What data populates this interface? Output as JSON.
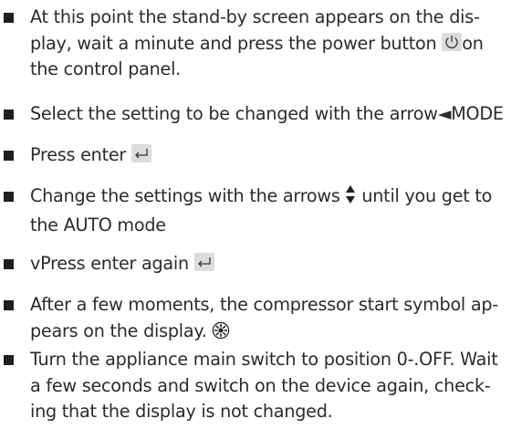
{
  "steps": [
    {
      "lines": [
        "At this point the stand-by screen appears on the dis-",
        "play, wait a minute and press the power button",
        "on",
        "the control panel."
      ],
      "icon": "power-icon"
    },
    {
      "text": "Select the setting to be changed with the arrow◄MODE"
    },
    {
      "text": "Press enter",
      "icon": "enter-icon"
    },
    {
      "text_before": "Change the settings with the arrows",
      "text_after": "until you get to",
      "text_line2": "the AUTO mode",
      "icon": "up-down-arrows-icon"
    },
    {
      "text": "vPress enter again",
      "icon": "enter-icon"
    },
    {
      "line1": "After a few moments, the compressor start symbol ap-",
      "line2": "pears on the display.",
      "icon": "compressor-start-icon"
    },
    {
      "line1": "Turn the appliance main switch to position 0-.OFF. Wait",
      "line2": "a few seconds and switch on the device again, check-",
      "line3": "ing that the display is not changed."
    }
  ]
}
